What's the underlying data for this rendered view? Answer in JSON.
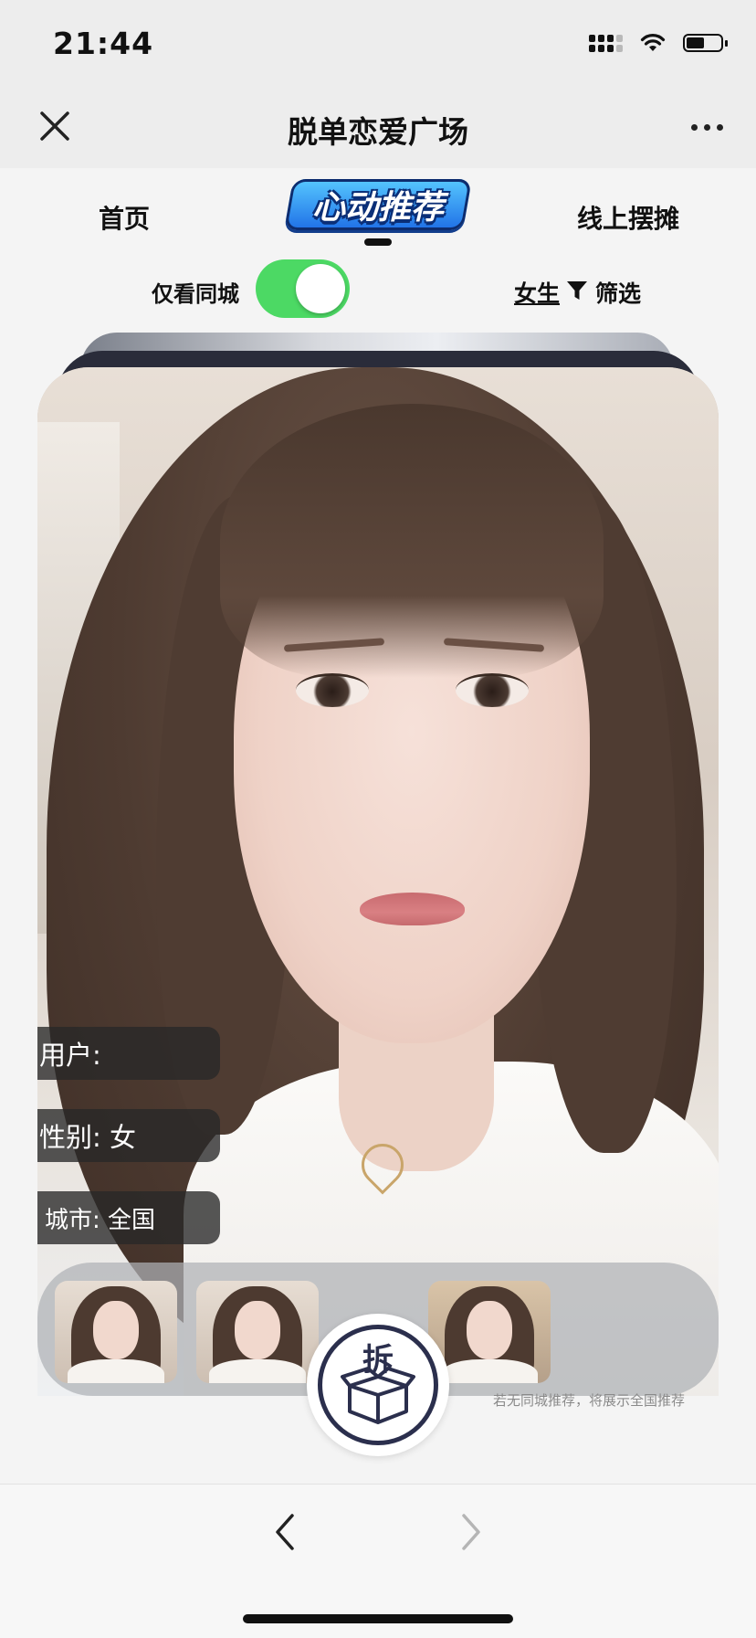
{
  "status_bar": {
    "time": "21:44",
    "icons": [
      "cellular-signal-icon",
      "wifi-icon",
      "battery-icon"
    ],
    "battery_level": 0.55
  },
  "nav_bar": {
    "title": "脱单恋爱广场",
    "close_icon": "close-icon",
    "more_icon": "more-icon"
  },
  "tabs": {
    "home": "首页",
    "featured": "心动推荐",
    "market": "线上摆摊",
    "active": "featured"
  },
  "filters": {
    "same_city_label": "仅看同城",
    "same_city_on": true,
    "gender": "女生",
    "filter_icon": "funnel-icon",
    "filter_label": "筛选"
  },
  "profile": {
    "user_label": "用户:",
    "gender_label": "性别: 女",
    "city_label": "城市: 全国"
  },
  "thumbnails": {
    "count": 3
  },
  "hint": "若无同城推荐，将展示全国推荐",
  "blind_box": {
    "char": "拆",
    "icon": "open-box-icon"
  },
  "bottom_nav": {
    "back_icon": "chevron-left-icon",
    "forward_icon": "chevron-right-icon"
  },
  "colors": {
    "toggle_on": "#4cd964",
    "badge_blue": "#1f6fe6",
    "box_navy": "#2b2f4d"
  }
}
